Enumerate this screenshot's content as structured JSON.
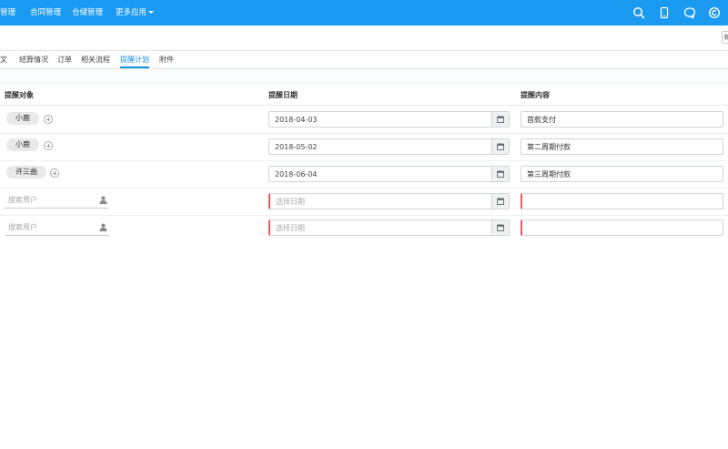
{
  "topnav": {
    "items": [
      "管理",
      "合同管理",
      "仓储管理",
      "更多应用"
    ],
    "icons": [
      "search-icon",
      "mobile-icon",
      "message-icon",
      "copyright-icon"
    ]
  },
  "sidebar_button_label": "和",
  "tabs": [
    "文",
    "结算情况",
    "订单",
    "相关流程",
    "提醒计划",
    "附件"
  ],
  "active_tab": "提醒计划",
  "columns": [
    "提醒对象",
    "提醒日期",
    "提醒内容"
  ],
  "rows": [
    {
      "user": "小鹿",
      "date": "2018-04-03",
      "content": "首款支付"
    },
    {
      "user": "小鹿",
      "date": "2018-05-02",
      "content": "第二周期付款"
    },
    {
      "user": "许三曲",
      "date": "2018-06-04",
      "content": "第三周期付款"
    }
  ],
  "empty_rows": [
    {
      "user_placeholder": "搜索用户",
      "date_placeholder": "选择日期",
      "content": ""
    },
    {
      "user_placeholder": "搜索用户",
      "date_placeholder": "选择日期",
      "content": ""
    }
  ],
  "colors": {
    "topbar": "#1a9af0",
    "active_tab": "#1a8ee0",
    "error_border": "#e85a5a"
  }
}
